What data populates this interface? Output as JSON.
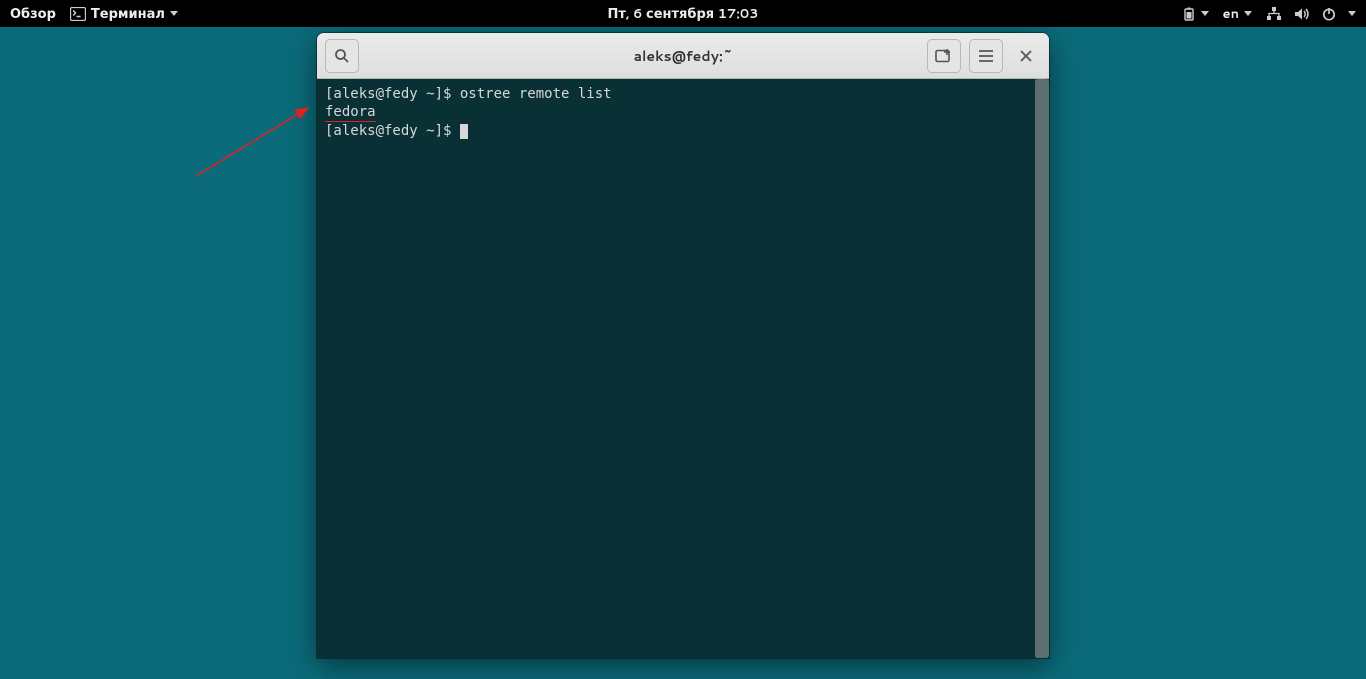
{
  "topbar": {
    "activities": "Обзор",
    "app_name": "Терминал",
    "datetime": "Пт, 6 сентября  17:03",
    "input_lang": "en"
  },
  "window": {
    "title": "aleks@fedy:~"
  },
  "terminal": {
    "prompt1": "[aleks@fedy ~]$ ",
    "command1": "ostree remote list",
    "output1": "fedora",
    "prompt2": "[aleks@fedy ~]$ "
  }
}
